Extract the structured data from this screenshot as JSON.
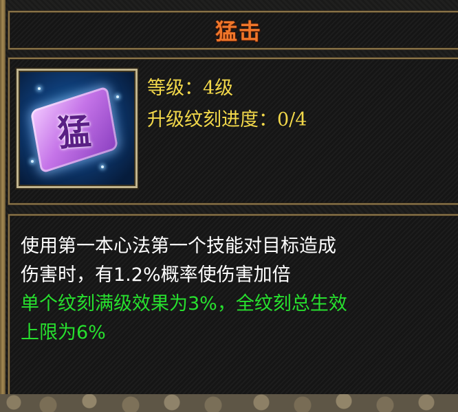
{
  "skill": {
    "title": "猛击",
    "icon": "skill-card-icon",
    "icon_glyph": "猛",
    "level_label": "等级：",
    "level_value": "4级",
    "progress_label": "升级纹刻进度：",
    "progress_value": "0/4",
    "description_line1": "使用第一本心法第一个技能对目标造成",
    "description_line2": "伤害时，有1.2%概率使伤害加倍",
    "bonus_line1": "单个纹刻满级效果为3%，全纹刻总生效",
    "bonus_line2": "上限为6%"
  },
  "colors": {
    "title": "#f0762a",
    "info_text": "#f2d84a",
    "description_text": "#ffffff",
    "bonus_text": "#27e02e",
    "border": "#8a7448"
  }
}
